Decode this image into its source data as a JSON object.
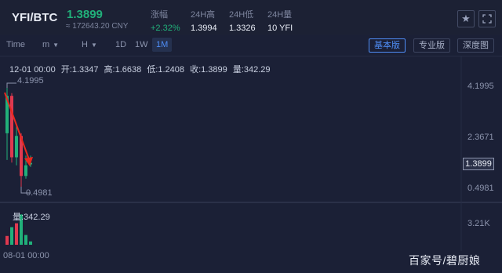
{
  "header": {
    "pair": "YFI/BTC",
    "price": "1.3899",
    "cny": "≈ 172643.20 CNY",
    "stats": [
      {
        "label": "涨幅",
        "value": "+2.32%"
      },
      {
        "label": "24H高",
        "value": "1.3994"
      },
      {
        "label": "24H低",
        "value": "1.3326"
      },
      {
        "label": "24H量",
        "value": "10 YFI"
      }
    ],
    "star_icon": "star-icon",
    "fullscreen_icon": "fullscreen-icon"
  },
  "toolbar": {
    "time_label": "Time",
    "minute_label": "m",
    "hour_label": "H",
    "intervals": [
      "1D",
      "1W",
      "1M"
    ],
    "active_interval": "1M",
    "versions": [
      "基本版",
      "专业版",
      "深度图"
    ],
    "active_version": "基本版"
  },
  "ohlc": {
    "date": "12-01 00:00",
    "open": "开:1.3347",
    "high": "高:1.6638",
    "low": "低:1.2408",
    "close": "收:1.3899",
    "volume": "量:342.29"
  },
  "chart": {
    "y_ticks": [
      "4.1995",
      "2.3671",
      "0.4981"
    ],
    "current_price": "1.3899",
    "high_marker": "4.1995",
    "low_marker": "0.4981",
    "volume_label": "量:342.29",
    "volume_tick": "3.21K",
    "x_start_label": "08-01 00:00",
    "up_color": "#21b07a",
    "down_color": "#e0394f",
    "annotation_color": "#e8281e"
  },
  "chart_data": {
    "type": "candlestick",
    "candles": [
      {
        "open": 2.5,
        "high": 4.1995,
        "low": 1.5,
        "close": 3.9,
        "direction": "up"
      },
      {
        "open": 3.9,
        "high": 4.0,
        "low": 1.4,
        "close": 1.6,
        "direction": "down"
      },
      {
        "open": 1.6,
        "high": 2.8,
        "low": 1.3,
        "close": 2.4,
        "direction": "up"
      },
      {
        "open": 2.4,
        "high": 2.5,
        "low": 0.4981,
        "close": 0.9,
        "direction": "down"
      },
      {
        "open": 0.9,
        "high": 1.6638,
        "low": 0.8,
        "close": 1.3,
        "direction": "up"
      },
      {
        "open": 1.3347,
        "high": 1.6638,
        "low": 1.2408,
        "close": 1.3899,
        "direction": "up"
      }
    ],
    "volumes": [
      {
        "value": 900,
        "direction": "down"
      },
      {
        "value": 1800,
        "direction": "up"
      },
      {
        "value": 2200,
        "direction": "down"
      },
      {
        "value": 3100,
        "direction": "up"
      },
      {
        "value": 1000,
        "direction": "up"
      },
      {
        "value": 342.29,
        "direction": "up"
      }
    ],
    "ylim": [
      0.4981,
      4.1995
    ],
    "volume_max": 3210
  },
  "watermark": "百家号/碧厨娘"
}
